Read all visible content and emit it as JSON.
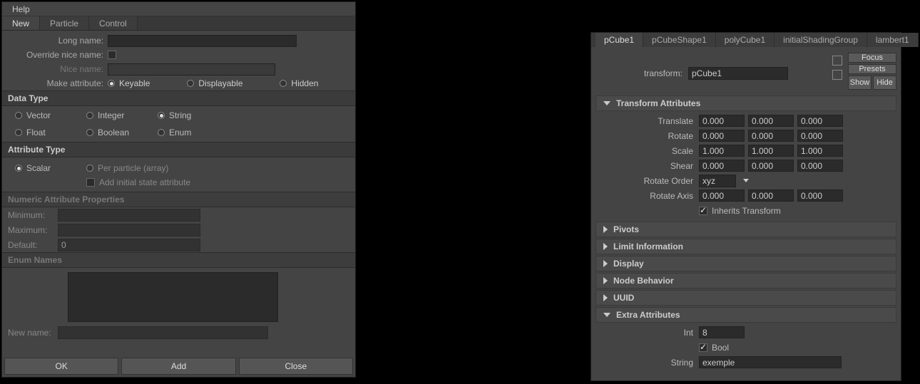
{
  "left": {
    "menubar": {
      "help": "Help"
    },
    "tabs": [
      "New",
      "Particle",
      "Control"
    ],
    "activeTab": 0,
    "fields": {
      "long_name_label": "Long name:",
      "long_name_value": "",
      "override_label": "Override nice name:",
      "nice_name_label": "Nice name:",
      "nice_name_value": "",
      "make_attr_label": "Make attribute:",
      "make_attr_options": [
        "Keyable",
        "Displayable",
        "Hidden"
      ],
      "make_attr_selected": 0
    },
    "data_type": {
      "header": "Data Type",
      "options": [
        "Vector",
        "Integer",
        "String",
        "Float",
        "Boolean",
        "Enum"
      ],
      "selected": 2
    },
    "attr_type": {
      "header": "Attribute Type",
      "options": [
        "Scalar",
        "Per particle (array)"
      ],
      "selected": 0,
      "checkbox_label": "Add initial state attribute"
    },
    "numeric": {
      "header": "Numeric Attribute Properties",
      "min_label": "Minimum:",
      "max_label": "Maximum:",
      "def_label": "Default:",
      "def_value": "0"
    },
    "enum": {
      "header": "Enum Names",
      "new_name_label": "New name:",
      "new_name_value": ""
    },
    "buttons": {
      "ok": "OK",
      "add": "Add",
      "close": "Close"
    }
  },
  "right": {
    "tabs": [
      "pCube1",
      "pCubeShape1",
      "polyCube1",
      "initialShadingGroup",
      "lambert1"
    ],
    "activeTab": 0,
    "header": {
      "node_label": "transform:",
      "node_value": "pCube1",
      "focus": "Focus",
      "presets": "Presets",
      "show": "Show",
      "hide": "Hide"
    },
    "transform": {
      "header": "Transform Attributes",
      "rows": [
        {
          "label": "Translate",
          "v": [
            "0.000",
            "0.000",
            "0.000"
          ]
        },
        {
          "label": "Rotate",
          "v": [
            "0.000",
            "0.000",
            "0.000"
          ]
        },
        {
          "label": "Scale",
          "v": [
            "1.000",
            "1.000",
            "1.000"
          ]
        },
        {
          "label": "Shear",
          "v": [
            "0.000",
            "0.000",
            "0.000"
          ]
        }
      ],
      "rotate_order_label": "Rotate Order",
      "rotate_order_value": "xyz",
      "rotate_axis_label": "Rotate Axis",
      "rotate_axis_v": [
        "0.000",
        "0.000",
        "0.000"
      ],
      "inherits_label": "Inherits Transform",
      "inherits_checked": true
    },
    "collapsed": [
      "Pivots",
      "Limit Information",
      "Display",
      "Node Behavior",
      "UUID"
    ],
    "extra": {
      "header": "Extra Attributes",
      "int_label": "Int",
      "int_value": "8",
      "bool_label": "Bool",
      "bool_checked": true,
      "string_label": "String",
      "string_value": "exemple"
    }
  }
}
